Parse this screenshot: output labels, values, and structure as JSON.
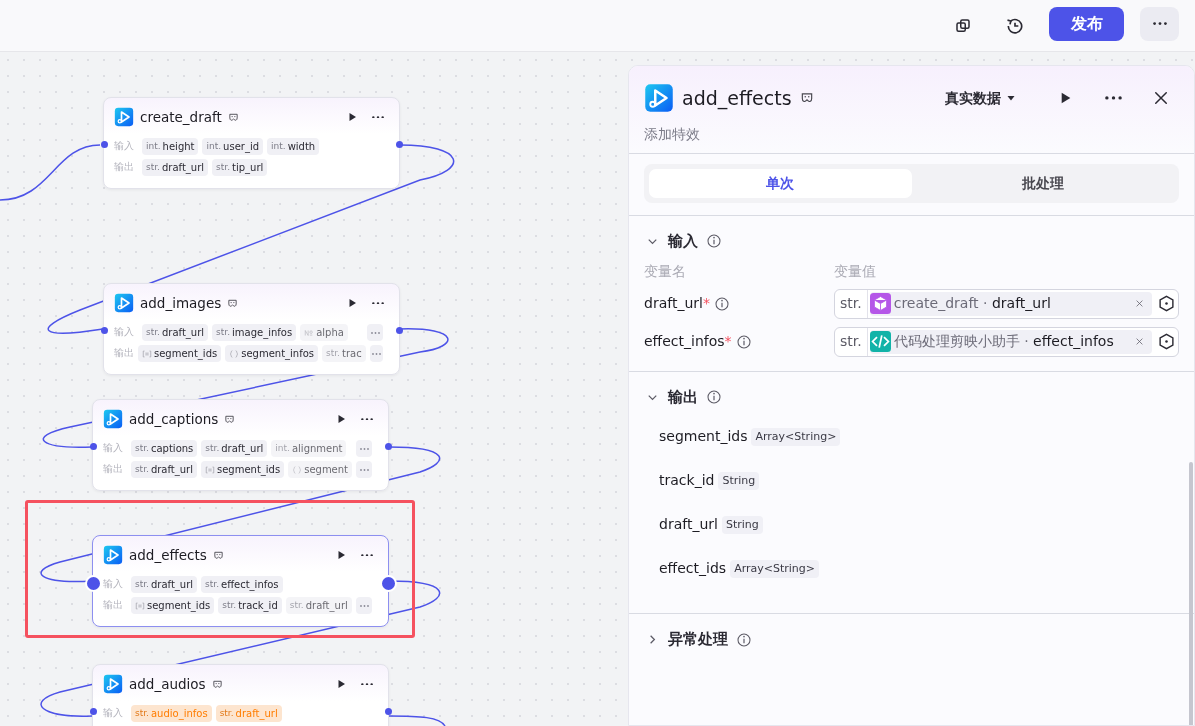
{
  "toolbar": {
    "publish": "发布"
  },
  "nodes": [
    {
      "title": "create_draft",
      "selected": false,
      "inputs_warning": false,
      "rows": [
        {
          "label": "输入",
          "more": false,
          "tags": [
            {
              "prefix": "int.",
              "name": "height",
              "faded": false
            },
            {
              "prefix": "int.",
              "name": "user_id",
              "faded": false
            },
            {
              "prefix": "int.",
              "name": "width",
              "faded": false
            }
          ]
        },
        {
          "label": "输出",
          "more": false,
          "tags": [
            {
              "prefix": "str.",
              "name": "draft_url",
              "faded": false
            },
            {
              "prefix": "str.",
              "name": "tip_url",
              "faded": false
            }
          ]
        }
      ]
    },
    {
      "title": "add_images",
      "selected": false,
      "inputs_warning": false,
      "rows": [
        {
          "label": "输入",
          "more": true,
          "tags": [
            {
              "prefix": "str.",
              "name": "draft_url",
              "faded": false
            },
            {
              "prefix": "str.",
              "name": "image_infos",
              "faded": false
            },
            {
              "kind": "number",
              "name": "alpha",
              "faded": true
            }
          ]
        },
        {
          "label": "输出",
          "more": true,
          "tags": [
            {
              "kind": "array",
              "name": "segment_ids",
              "faded": false
            },
            {
              "kind": "object",
              "name": "segment_infos",
              "faded": false
            },
            {
              "prefix": "str.",
              "name": "trac",
              "faded": true
            }
          ]
        }
      ]
    },
    {
      "title": "add_captions",
      "selected": false,
      "inputs_warning": false,
      "rows": [
        {
          "label": "输入",
          "more": true,
          "tags": [
            {
              "prefix": "str.",
              "name": "captions",
              "faded": false
            },
            {
              "prefix": "str.",
              "name": "draft_url",
              "faded": false
            },
            {
              "prefix": "int.",
              "name": "alignment",
              "faded": true
            }
          ]
        },
        {
          "label": "输出",
          "more": true,
          "tags": [
            {
              "prefix": "str.",
              "name": "draft_url",
              "faded": false
            },
            {
              "kind": "array",
              "name": "segment_ids",
              "faded": false
            },
            {
              "kind": "object",
              "name": "segment",
              "faded": true
            }
          ]
        }
      ]
    },
    {
      "title": "add_effects",
      "selected": true,
      "inputs_warning": false,
      "rows": [
        {
          "label": "输入",
          "more": false,
          "tags": [
            {
              "prefix": "str.",
              "name": "draft_url",
              "faded": false
            },
            {
              "prefix": "str.",
              "name": "effect_infos",
              "faded": false
            }
          ]
        },
        {
          "label": "输出",
          "more": true,
          "tags": [
            {
              "kind": "array",
              "name": "segment_ids",
              "faded": false
            },
            {
              "prefix": "str.",
              "name": "track_id",
              "faded": false
            },
            {
              "prefix": "str.",
              "name": "draft_url",
              "faded": true
            }
          ]
        }
      ]
    },
    {
      "title": "add_audios",
      "selected": false,
      "inputs_warning": true,
      "rows": [
        {
          "label": "输入",
          "more": false,
          "tags": [
            {
              "prefix": "str.",
              "name": "audio_infos",
              "faded": false
            },
            {
              "prefix": "str.",
              "name": "draft_url",
              "faded": false
            }
          ]
        }
      ]
    }
  ],
  "panel": {
    "title": "add_effects",
    "description": "添加特效",
    "data_mode": "真实数据",
    "tabs": [
      {
        "label": "单次",
        "selected": true
      },
      {
        "label": "批处理",
        "selected": false
      }
    ],
    "input_section": {
      "title": "输入",
      "expanded": true,
      "name_header": "变量名",
      "value_header": "变量值",
      "params": [
        {
          "name": "draft_url",
          "required_mark": "*",
          "type": "str.",
          "kind": "node",
          "source": "create_draft",
          "separator": "·",
          "field": "draft_url"
        },
        {
          "name": "effect_infos",
          "required_mark": "*",
          "type": "str.",
          "kind": "code",
          "source": "代码处理剪映小助手",
          "separator": "·",
          "field": "effect_infos"
        }
      ]
    },
    "output_section": {
      "title": "输出",
      "expanded": true,
      "outputs": [
        {
          "name": "segment_ids",
          "type": "Array<String>"
        },
        {
          "name": "track_id",
          "type": "String"
        },
        {
          "name": "draft_url",
          "type": "String"
        },
        {
          "name": "effect_ids",
          "type": "Array<String>"
        }
      ]
    },
    "error_section": {
      "title": "异常处理",
      "expanded": false
    }
  }
}
